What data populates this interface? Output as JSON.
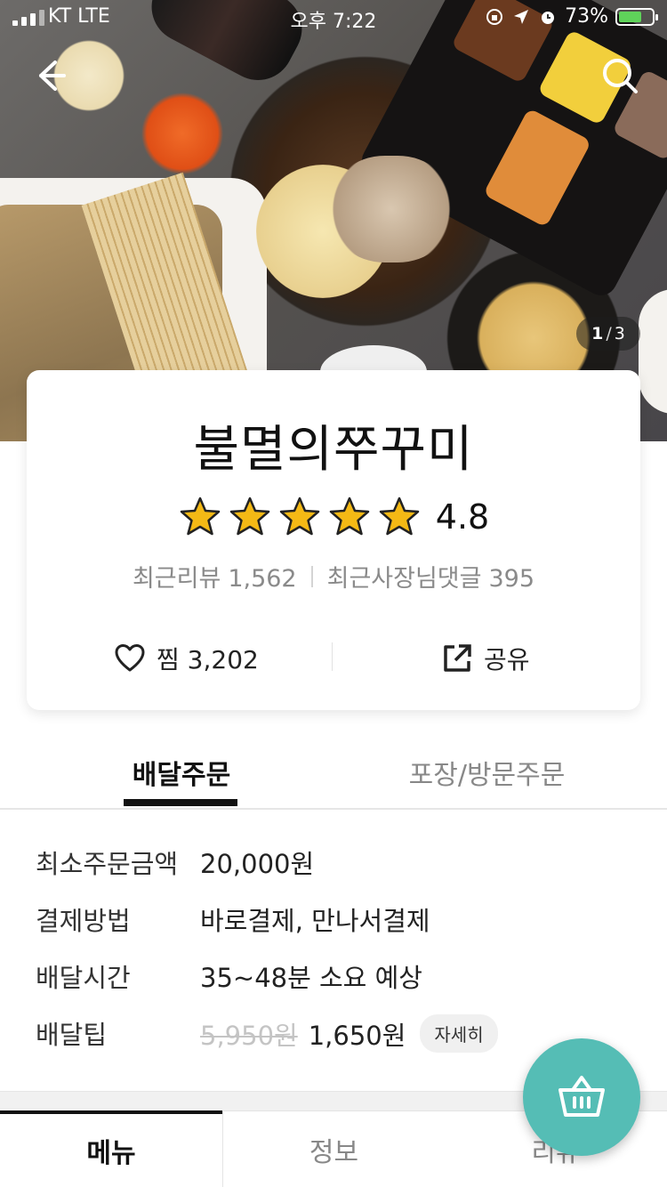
{
  "status_bar": {
    "carrier": "KT  LTE",
    "time": "오후 7:22",
    "battery": "73%",
    "battery_level": 0.73
  },
  "hero": {
    "counter_current": "1",
    "counter_total": "3"
  },
  "shop": {
    "name": "불멸의쭈꾸미",
    "rating": "4.8",
    "star_count": 5,
    "recent_reviews_label": "최근리뷰",
    "recent_reviews_count": "1,562",
    "owner_replies_label": "최근사장님댓글",
    "owner_replies_count": "395",
    "like_label": "찜 3,202",
    "share_label": "공유"
  },
  "order_tabs": {
    "delivery": "배달주문",
    "pickup": "포장/방문주문"
  },
  "info": {
    "min_order_label": "최소주문금액",
    "min_order_value": "20,000원",
    "payment_label": "결제방법",
    "payment_value": "바로결제, 만나서결제",
    "time_label": "배달시간",
    "time_value": "35~48분 소요 예상",
    "tip_label": "배달팁",
    "tip_original": "5,950원",
    "tip_value": "1,650원",
    "tip_detail": "자세히"
  },
  "bottom_tabs": {
    "menu": "메뉴",
    "info": "정보",
    "review": "리뷰"
  },
  "colors": {
    "accent": "#55bdb5",
    "star": "#f4b915"
  },
  "icons": [
    "back-arrow-icon",
    "search-icon",
    "star-icon",
    "heart-icon",
    "share-icon",
    "cart-icon"
  ]
}
